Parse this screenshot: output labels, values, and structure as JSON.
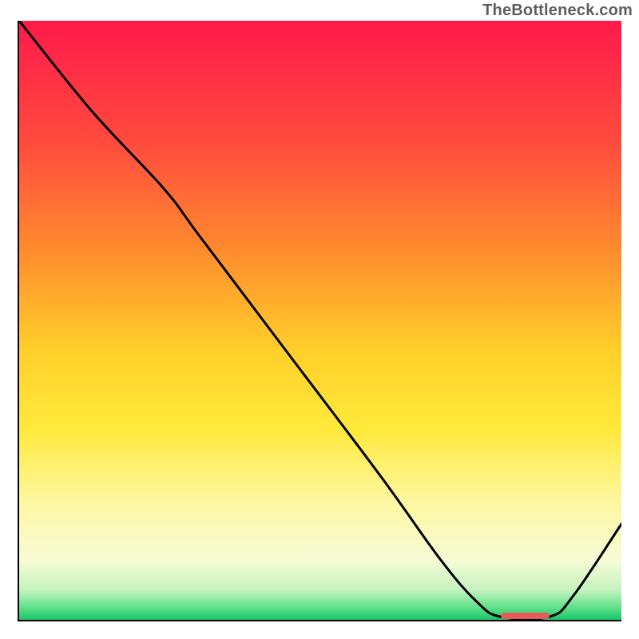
{
  "attribution": "TheBottleneck.com",
  "chart_data": {
    "type": "line",
    "title": "",
    "xlabel": "",
    "ylabel": "",
    "x_range": [
      0,
      100
    ],
    "y_range": [
      0,
      100
    ],
    "background_gradient": {
      "stops": [
        {
          "offset": 0,
          "color": "#ff1a4b"
        },
        {
          "offset": 20,
          "color": "#ff4a3e"
        },
        {
          "offset": 38,
          "color": "#ff8a2e"
        },
        {
          "offset": 55,
          "color": "#ffcf2a"
        },
        {
          "offset": 68,
          "color": "#ffe93a"
        },
        {
          "offset": 80,
          "color": "#fdf79e"
        },
        {
          "offset": 90,
          "color": "#f7fbd6"
        },
        {
          "offset": 95,
          "color": "#c6f3c0"
        },
        {
          "offset": 98,
          "color": "#5ee089"
        },
        {
          "offset": 100,
          "color": "#18c56b"
        }
      ]
    },
    "series": [
      {
        "name": "bottleneck-curve",
        "color": "#000000",
        "points": [
          {
            "x": 0,
            "y": 100
          },
          {
            "x": 12,
            "y": 85
          },
          {
            "x": 24,
            "y": 72
          },
          {
            "x": 30,
            "y": 64
          },
          {
            "x": 45,
            "y": 44
          },
          {
            "x": 60,
            "y": 24
          },
          {
            "x": 70,
            "y": 10
          },
          {
            "x": 76,
            "y": 3
          },
          {
            "x": 80,
            "y": 0.5
          },
          {
            "x": 88,
            "y": 0.5
          },
          {
            "x": 92,
            "y": 4
          },
          {
            "x": 100,
            "y": 16
          }
        ]
      }
    ],
    "optimal_marker": {
      "x_start": 80,
      "x_end": 88,
      "color": "#e85a5a"
    }
  }
}
